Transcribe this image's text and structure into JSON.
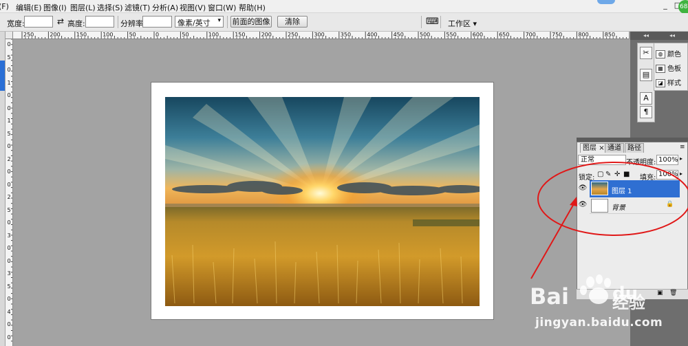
{
  "menubar": {
    "items": [
      {
        "label": "(F)"
      },
      {
        "label": "编辑(E)"
      },
      {
        "label": "图像(I)"
      },
      {
        "label": "图层(L)"
      },
      {
        "label": "选择(S)"
      },
      {
        "label": "滤镜(T)"
      },
      {
        "label": "分析(A)"
      },
      {
        "label": "视图(V)"
      },
      {
        "label": "窗口(W)"
      },
      {
        "label": "帮助(H)"
      }
    ],
    "window_buttons": [
      "_",
      "□"
    ],
    "corner_badge": "68"
  },
  "options": {
    "width_label": "宽度:",
    "width_value": "",
    "swap_icon": "swap-arrows-icon",
    "height_label": "高度:",
    "height_value": "",
    "resolution_label": "分辨率:",
    "resolution_value": "",
    "unit_select": "像素/英寸",
    "front_image_button": "前面的图像",
    "clear_button": "清除",
    "workspace_label": "工作区"
  },
  "rulers": {
    "horizontal": [
      "250",
      "200",
      "150",
      "100",
      "50",
      "0",
      "50",
      "100",
      "150",
      "200",
      "250",
      "300",
      "350",
      "400",
      "450",
      "500",
      "550",
      "600",
      "650",
      "700",
      "750",
      "800",
      "850"
    ],
    "vertical": [
      "0",
      "5",
      "0",
      "1",
      "0",
      "0",
      "1",
      "5",
      "0",
      "2",
      "0",
      "0",
      "2",
      "5",
      "0",
      "3",
      "0",
      "0",
      "3",
      "5",
      "0",
      "4",
      "0",
      "0"
    ]
  },
  "dock": {
    "swatches": [
      {
        "label": "颜色",
        "icon": "palette-icon"
      },
      {
        "label": "色板",
        "icon": "swatches-grid-icon"
      },
      {
        "label": "样式",
        "icon": "styles-icon"
      }
    ],
    "tools": [
      "brush-tools-icon",
      "clone-source-icon",
      "character-icon",
      "paragraph-icon"
    ]
  },
  "layers_panel": {
    "tabs": [
      {
        "label": "图层",
        "close": "×"
      },
      {
        "label": "通道"
      },
      {
        "label": "路径"
      }
    ],
    "blend_mode": "正常",
    "opacity_label": "不透明度:",
    "opacity_value": "100%",
    "lock_label": "锁定:",
    "fill_label": "填充:",
    "fill_value": "100%",
    "layers": [
      {
        "name": "图层 1",
        "selected": true,
        "visible": true
      },
      {
        "name": "背景",
        "selected": false,
        "visible": true,
        "locked": true
      }
    ]
  },
  "document": {
    "has_photo": true,
    "photo_subject": "golden wheat field at sunset"
  },
  "watermark": {
    "brand": "Bai",
    "brand2": "du",
    "cn": "经验",
    "url": "jingyan.baidu.com"
  },
  "colors": {
    "accent_selected": "#2f6fd2",
    "annotation_red": "#e01818"
  }
}
